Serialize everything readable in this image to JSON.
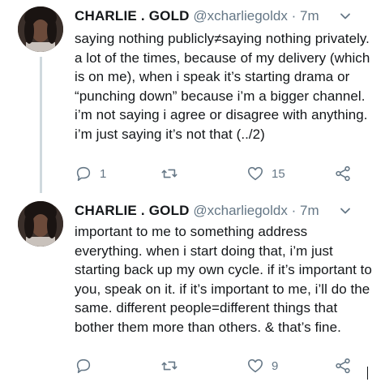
{
  "tweets": [
    {
      "name": "CHARLIE . GOLD",
      "handle": "@xcharliegoldx",
      "separator": "·",
      "time": "7m",
      "text": "saying nothing publicly≠saying nothing privately. a lot of the times, because of my delivery (which is on me), when i speak it’s starting drama or “punching down” because i’m a bigger channel. i’m not saying i agree or disagree with anything. i’m just saying it’s not that (../2)",
      "reply_count": "1",
      "retweet_count": "",
      "like_count": "15"
    },
    {
      "name": "CHARLIE . GOLD",
      "handle": "@xcharliegoldx",
      "separator": "·",
      "time": "7m",
      "text": "important to me to something address everything. when i start doing that, i’m just starting back up my own cycle. if it’s important to you, speak on it. if it’s important to me, i’ll do the same. different people=different things that bother them more than others. & that’s fine.",
      "reply_count": "",
      "retweet_count": "",
      "like_count": "9"
    }
  ],
  "colors": {
    "secondary_text": "#657786",
    "primary_text": "#14171a",
    "thread_line": "#cfd9de"
  },
  "icons": [
    "chevron-down-icon",
    "reply-icon",
    "retweet-icon",
    "like-icon",
    "share-icon"
  ]
}
